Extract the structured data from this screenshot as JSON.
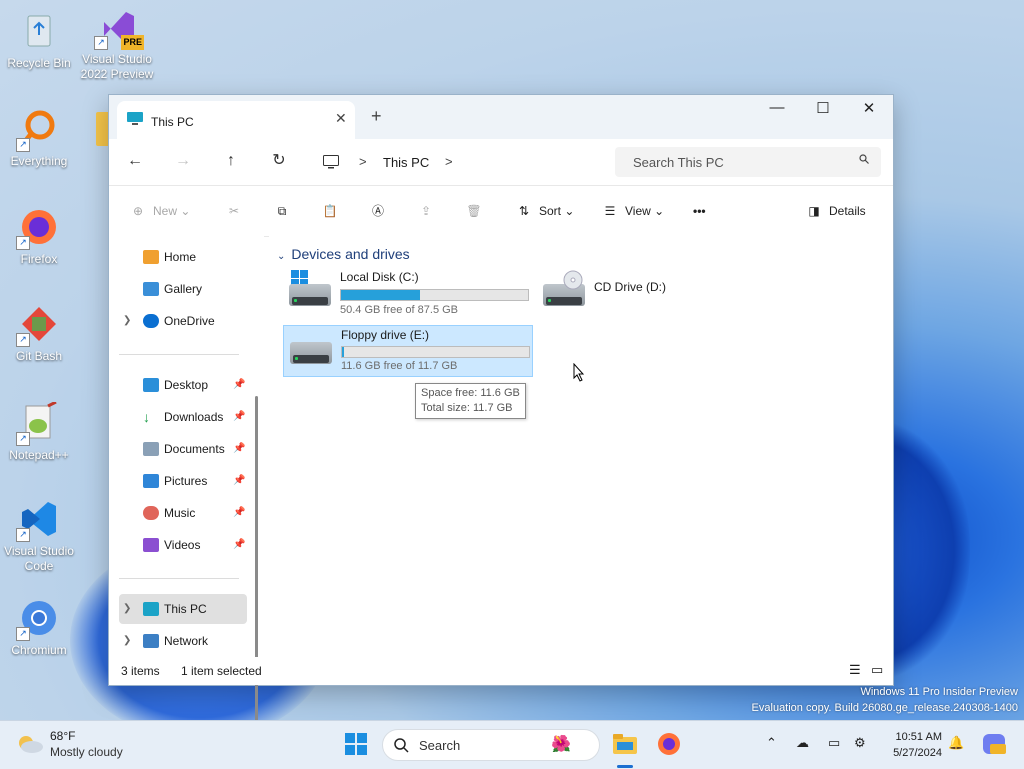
{
  "desktop": {
    "icons": [
      {
        "label": "Recycle Bin"
      },
      {
        "label": "Visual Studio 2022 Preview",
        "badge": "PRE"
      },
      {
        "label": "Everything"
      },
      {
        "label": "Firefox"
      },
      {
        "label": "Git Bash"
      },
      {
        "label": "Notepad++"
      },
      {
        "label": "Visual Studio Code"
      },
      {
        "label": "Chromium"
      }
    ],
    "watermark": {
      "line1": "Windows 11 Pro Insider Preview",
      "line2": "Evaluation copy. Build 26080.ge_release.240308-1400"
    }
  },
  "window": {
    "tab_title": "This PC",
    "new_tab": "+",
    "controls": {
      "minimize": "—",
      "maximize": "☐",
      "close": "✕"
    },
    "breadcrumb": {
      "location": "This PC",
      "separator": ">"
    },
    "search_placeholder": "Search This PC",
    "commands": {
      "new": "New",
      "sort": "Sort",
      "view": "View",
      "more": "•••",
      "details": "Details"
    },
    "sidebar": {
      "home": "Home",
      "gallery": "Gallery",
      "onedrive": "OneDrive",
      "pinned": [
        "Desktop",
        "Downloads",
        "Documents",
        "Pictures",
        "Music",
        "Videos"
      ],
      "this_pc": "This PC",
      "network": "Network"
    },
    "group_header": "Devices and drives",
    "drives": [
      {
        "name": "Local Disk (C:)",
        "free_text": "50.4 GB free of 87.5 GB",
        "used_fraction": 0.424
      },
      {
        "name": "CD Drive (D:)"
      },
      {
        "name": "Floppy drive (E:)",
        "free_text": "11.6 GB free of 11.7 GB",
        "used_fraction": 0.009
      }
    ],
    "tooltip": {
      "line1": "Space free: 11.6 GB",
      "line2": "Total size: 11.7 GB"
    },
    "status": {
      "items": "3 items",
      "selected": "1 item selected"
    }
  },
  "taskbar": {
    "weather": {
      "temp": "68°F",
      "desc": "Mostly cloudy"
    },
    "search_label": "Search",
    "clock": {
      "time": "10:51 AM",
      "date": "5/27/2024"
    }
  },
  "colors": {
    "accent": "#26a0da",
    "selection": "#cce8ff",
    "folder_header": "#1f3f7a"
  }
}
